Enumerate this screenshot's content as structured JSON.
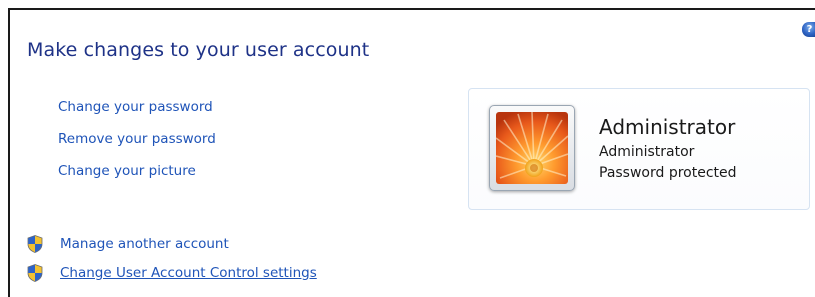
{
  "help": {
    "icon": "help-icon",
    "glyph": "?"
  },
  "page": {
    "title": "Make changes to your user account"
  },
  "tasks": [
    {
      "label": "Change your password"
    },
    {
      "label": "Remove your password"
    },
    {
      "label": "Change your picture"
    }
  ],
  "account": {
    "name": "Administrator",
    "role": "Administrator",
    "status": "Password protected",
    "picture_icon": "flower-picture"
  },
  "admin_tasks": [
    {
      "label": "Manage another account",
      "icon": "uac-shield-icon"
    },
    {
      "label": "Change User Account Control settings",
      "icon": "uac-shield-icon"
    }
  ],
  "colors": {
    "title": "#1e3287",
    "link": "#1f54b8",
    "text": "#1a1a1a"
  }
}
